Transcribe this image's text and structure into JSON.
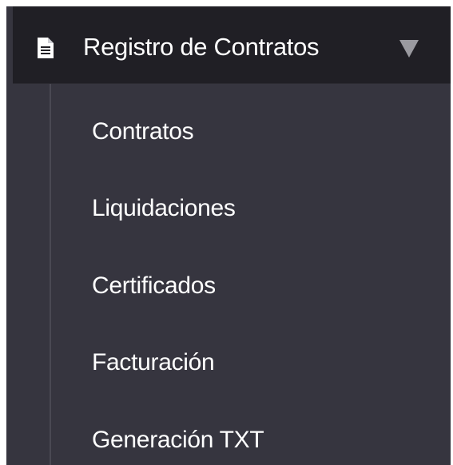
{
  "menu": {
    "group_label": "Registro de Contratos",
    "group_icon": "document-icon",
    "expand_icon": "caret-down-icon",
    "expanded": true,
    "items": [
      {
        "label": "Contratos"
      },
      {
        "label": "Liquidaciones"
      },
      {
        "label": "Certificados"
      },
      {
        "label": "Facturación"
      },
      {
        "label": "Generación TXT"
      }
    ]
  },
  "colors": {
    "sidebar_bg": "#36353f",
    "header_bg": "#201f25",
    "text": "#ffffff",
    "caret": "#9a9aa0",
    "tree_line": "#4a4953"
  }
}
